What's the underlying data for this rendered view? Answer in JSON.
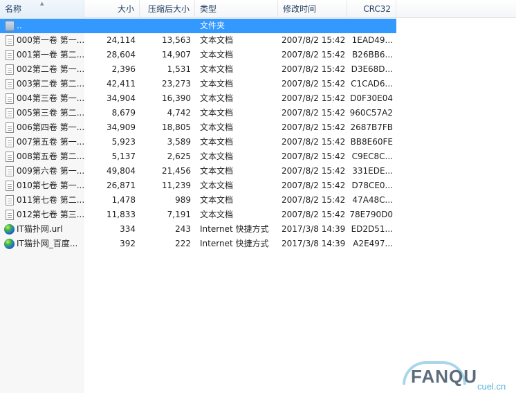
{
  "columns": {
    "name": "名称",
    "size": "大小",
    "compressed": "压缩后大小",
    "type": "类型",
    "modified": "修改时间",
    "crc": "CRC32"
  },
  "selected_row": 0,
  "rows": [
    {
      "name": "..",
      "size": "",
      "compressed": "",
      "type": "文件夹",
      "modified": "",
      "crc": "",
      "icon": "folder-up-icon"
    },
    {
      "name": "000第一卷 第一...",
      "size": "24,114",
      "compressed": "13,563",
      "type": "文本文档",
      "modified": "2007/8/2 15:42",
      "crc": "1EAD49...",
      "icon": "text-document-icon"
    },
    {
      "name": "001第一卷 第二...",
      "size": "28,604",
      "compressed": "14,907",
      "type": "文本文档",
      "modified": "2007/8/2 15:42",
      "crc": "B26BB6...",
      "icon": "text-document-icon"
    },
    {
      "name": "002第二卷 第一...",
      "size": "2,396",
      "compressed": "1,531",
      "type": "文本文档",
      "modified": "2007/8/2 15:42",
      "crc": "D3E68D...",
      "icon": "text-document-icon"
    },
    {
      "name": "003第二卷 第二...",
      "size": "42,411",
      "compressed": "23,273",
      "type": "文本文档",
      "modified": "2007/8/2 15:42",
      "crc": "C1CAD6...",
      "icon": "text-document-icon"
    },
    {
      "name": "004第三卷 第一...",
      "size": "34,904",
      "compressed": "16,390",
      "type": "文本文档",
      "modified": "2007/8/2 15:42",
      "crc": "D0F30E04",
      "icon": "text-document-icon"
    },
    {
      "name": "005第三卷 第二...",
      "size": "8,679",
      "compressed": "4,742",
      "type": "文本文档",
      "modified": "2007/8/2 15:42",
      "crc": "960C57A2",
      "icon": "text-document-icon"
    },
    {
      "name": "006第四卷 第一...",
      "size": "34,909",
      "compressed": "18,805",
      "type": "文本文档",
      "modified": "2007/8/2 15:42",
      "crc": "2687B7FB",
      "icon": "text-document-icon"
    },
    {
      "name": "007第五卷 第一...",
      "size": "5,923",
      "compressed": "3,589",
      "type": "文本文档",
      "modified": "2007/8/2 15:42",
      "crc": "BB8E60FE",
      "icon": "text-document-icon"
    },
    {
      "name": "008第五卷 第二...",
      "size": "5,137",
      "compressed": "2,625",
      "type": "文本文档",
      "modified": "2007/8/2 15:42",
      "crc": "C9EC8C...",
      "icon": "text-document-icon"
    },
    {
      "name": "009第六卷 第一...",
      "size": "49,804",
      "compressed": "21,456",
      "type": "文本文档",
      "modified": "2007/8/2 15:42",
      "crc": "331EDE...",
      "icon": "text-document-icon"
    },
    {
      "name": "010第七卷 第一...",
      "size": "26,871",
      "compressed": "11,239",
      "type": "文本文档",
      "modified": "2007/8/2 15:42",
      "crc": "D78CE0...",
      "icon": "text-document-icon"
    },
    {
      "name": "011第七卷 第二...",
      "size": "1,478",
      "compressed": "989",
      "type": "文本文档",
      "modified": "2007/8/2 15:42",
      "crc": "47A48C...",
      "icon": "text-document-icon"
    },
    {
      "name": "012第七卷 第三...",
      "size": "11,833",
      "compressed": "7,191",
      "type": "文本文档",
      "modified": "2007/8/2 15:42",
      "crc": "78E790D0",
      "icon": "text-document-icon"
    },
    {
      "name": "IT猫扑网.url",
      "size": "334",
      "compressed": "243",
      "type": "Internet 快捷方式",
      "modified": "2017/3/8 14:39",
      "crc": "ED2D51...",
      "icon": "internet-shortcut-icon"
    },
    {
      "name": "IT猫扑网_百度...",
      "size": "392",
      "compressed": "222",
      "type": "Internet 快捷方式",
      "modified": "2017/3/8 14:39",
      "crc": "A2E497...",
      "icon": "internet-shortcut-icon"
    }
  ],
  "watermark": {
    "text": "FANQU",
    "sub": "cuel.cn"
  },
  "colors": {
    "selection": "#3399ff",
    "header_text": "#1e3a5f"
  }
}
